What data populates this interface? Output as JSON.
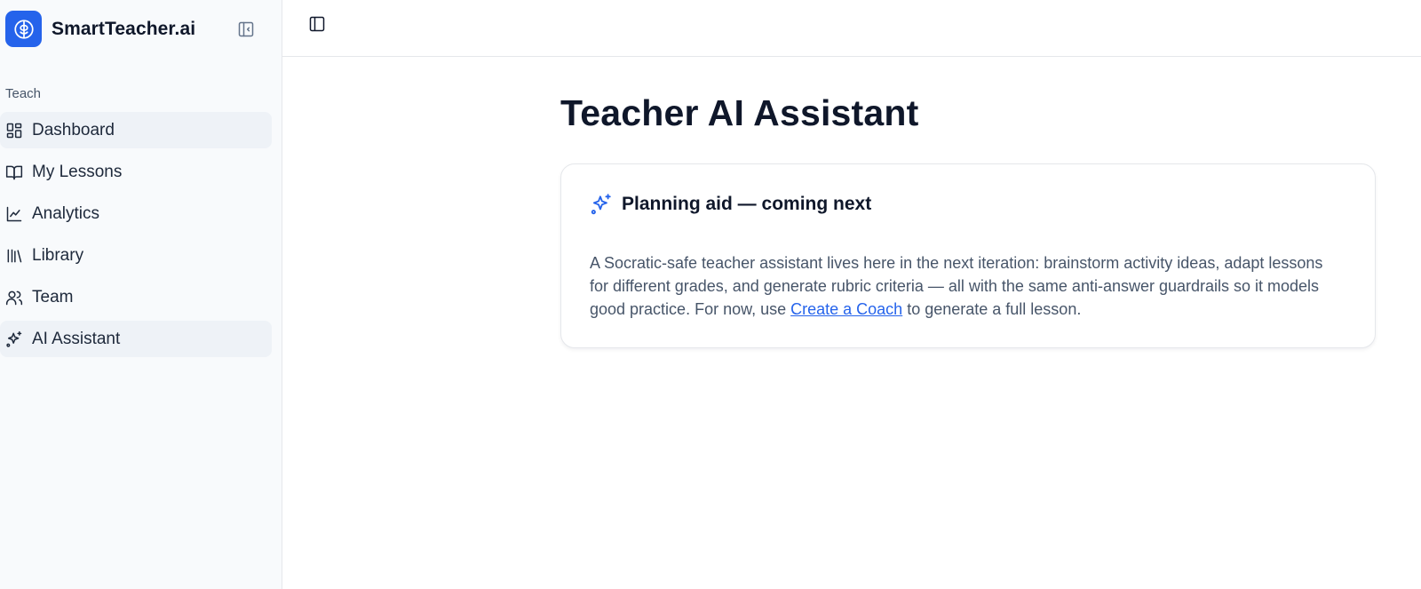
{
  "brand": {
    "name": "SmartTeacher.ai"
  },
  "sidebar": {
    "section_label": "Teach",
    "items": [
      {
        "label": "Dashboard",
        "icon": "dashboard-icon"
      },
      {
        "label": "My Lessons",
        "icon": "book-open-icon"
      },
      {
        "label": "Analytics",
        "icon": "line-chart-icon"
      },
      {
        "label": "Library",
        "icon": "library-icon"
      },
      {
        "label": "Team",
        "icon": "users-icon"
      },
      {
        "label": "AI Assistant",
        "icon": "sparkles-icon"
      }
    ]
  },
  "main": {
    "title": "Teacher AI Assistant",
    "card": {
      "title": "Planning aid — coming next",
      "body_before": "A Socratic-safe teacher assistant lives here in the next iteration: brainstorm activity ideas, adapt lessons for different grades, and generate rubric criteria — all with the same anti-answer guardrails so it models good practice. For now, use ",
      "link_text": "Create a Coach",
      "body_after": " to generate a full lesson."
    }
  },
  "colors": {
    "accent": "#2563eb",
    "sidebar_bg": "#f8fafc",
    "highlight": "#eef2f7"
  }
}
